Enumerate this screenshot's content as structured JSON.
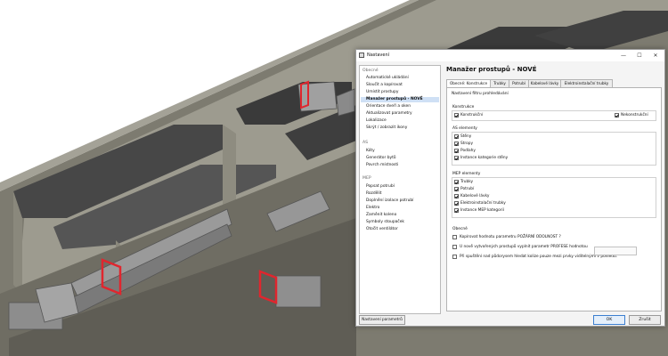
{
  "window": {
    "title": "Nastavení",
    "minimize_glyph": "—",
    "maximize_glyph": "☐",
    "close_glyph": "✕"
  },
  "sidebar": {
    "groups": [
      {
        "label": "Obecné",
        "items": [
          "Automatické ukládání",
          "Sloučit a kopírovat",
          "Umístit prostupy",
          "Manažer prostupů - NOVÉ",
          "Orientace dveří a oken",
          "Aktualizovat parametry",
          "Lokalizace",
          "Skrýt / zobrazit ikony"
        ]
      },
      {
        "label": "AS",
        "items": [
          "Kóty",
          "Generátor bytů",
          "Povrch místnosti"
        ]
      },
      {
        "label": "MEP",
        "items": [
          "Popsat potrubí",
          "Rozdělit",
          "Doplnění izolace potrubí",
          "Elektro",
          "Zaměnit koleno",
          "Symboly stoupaček",
          "Otočit ventilátor"
        ]
      }
    ],
    "selected_item": "Manažer prostupů - NOVÉ",
    "params_button": "Nastavení parametrů"
  },
  "main": {
    "heading": "Manažer prostupů - NOVÉ",
    "tabs": [
      "Obecné: Konstrukce",
      "Trubky",
      "Potrubí",
      "Kabelové lávky",
      "Elektroinstalační trubky"
    ],
    "active_tab": "Obecné: Konstrukce",
    "filter_title": "Nastavení filtru prohledávání",
    "konstrukce": {
      "title": "Konstrukce",
      "items": [
        {
          "label": "Konstrukční",
          "checked": true
        },
        {
          "label": "Nekonstrukční",
          "checked": true
        }
      ]
    },
    "as_elements": {
      "title": "AS elementy",
      "items": [
        {
          "label": "Stěny",
          "checked": true
        },
        {
          "label": "Stropy",
          "checked": true
        },
        {
          "label": "Podlahy",
          "checked": true
        },
        {
          "label": "Instance kategorie stěny",
          "checked": true
        }
      ]
    },
    "mep_elements": {
      "title": "MEP elementy",
      "items": [
        {
          "label": "Trubky",
          "checked": true
        },
        {
          "label": "Potrubí",
          "checked": true
        },
        {
          "label": "Kabelové lávky",
          "checked": true
        },
        {
          "label": "Elektroinstalační trubky",
          "checked": true
        },
        {
          "label": "Instance MEP kategorií",
          "checked": true
        }
      ]
    },
    "general": {
      "title": "Obecné",
      "items": [
        {
          "label": "Kopírovat hodnotu parametru POŽÁRNÍ ODOLNOST ?",
          "checked": false
        },
        {
          "label": "U nově vytvořených prostupů vyplnit parametr PROFESE hodnotou",
          "checked": false
        },
        {
          "label": "Při spuštění nad půdorysem hledat kolize pouze mezi prvky viditelnými v pohledu.",
          "checked": false
        }
      ],
      "profese_value": ""
    }
  },
  "footer": {
    "ok": "OK",
    "cancel": "Zrušit"
  },
  "colors": {
    "selection": "#cfe0f5",
    "opening_red": "#e0262e"
  }
}
